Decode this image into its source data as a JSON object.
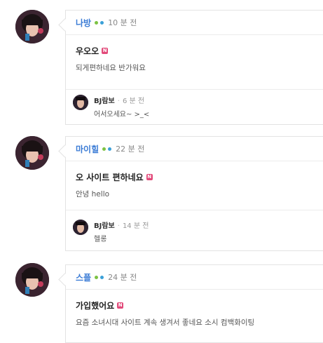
{
  "posts": [
    {
      "author": "나방",
      "dots": [
        "#7cc242",
        "#3aa0d8"
      ],
      "time": "10 분 전",
      "title": "우오오",
      "badge": "N",
      "text": "되게편하네요 반가워요",
      "reply": {
        "author": "BJ람보",
        "time": "6 분 전",
        "text": "어서오세요~ >_<"
      }
    },
    {
      "author": "마이힐",
      "dots": [
        "#7cc242",
        "#3aa0d8"
      ],
      "time": "22 분 전",
      "title": "오 사이트 편하네요",
      "badge": "N",
      "text": "안녕 hello",
      "reply": {
        "author": "BJ람보",
        "time": "14 분 전",
        "text": "헬롱"
      }
    },
    {
      "author": "스플",
      "dots": [
        "#7cc242",
        "#3aa0d8"
      ],
      "time": "24 분 전",
      "title": "가입했어요",
      "badge": "N",
      "text": "요즘 소녀시대 사이트 계속 생겨서 좋네요 소시 컴백화이팅"
    }
  ],
  "separator": "·",
  "colors": {
    "author": "#3a7bd5",
    "badge": "#e24a7a"
  }
}
